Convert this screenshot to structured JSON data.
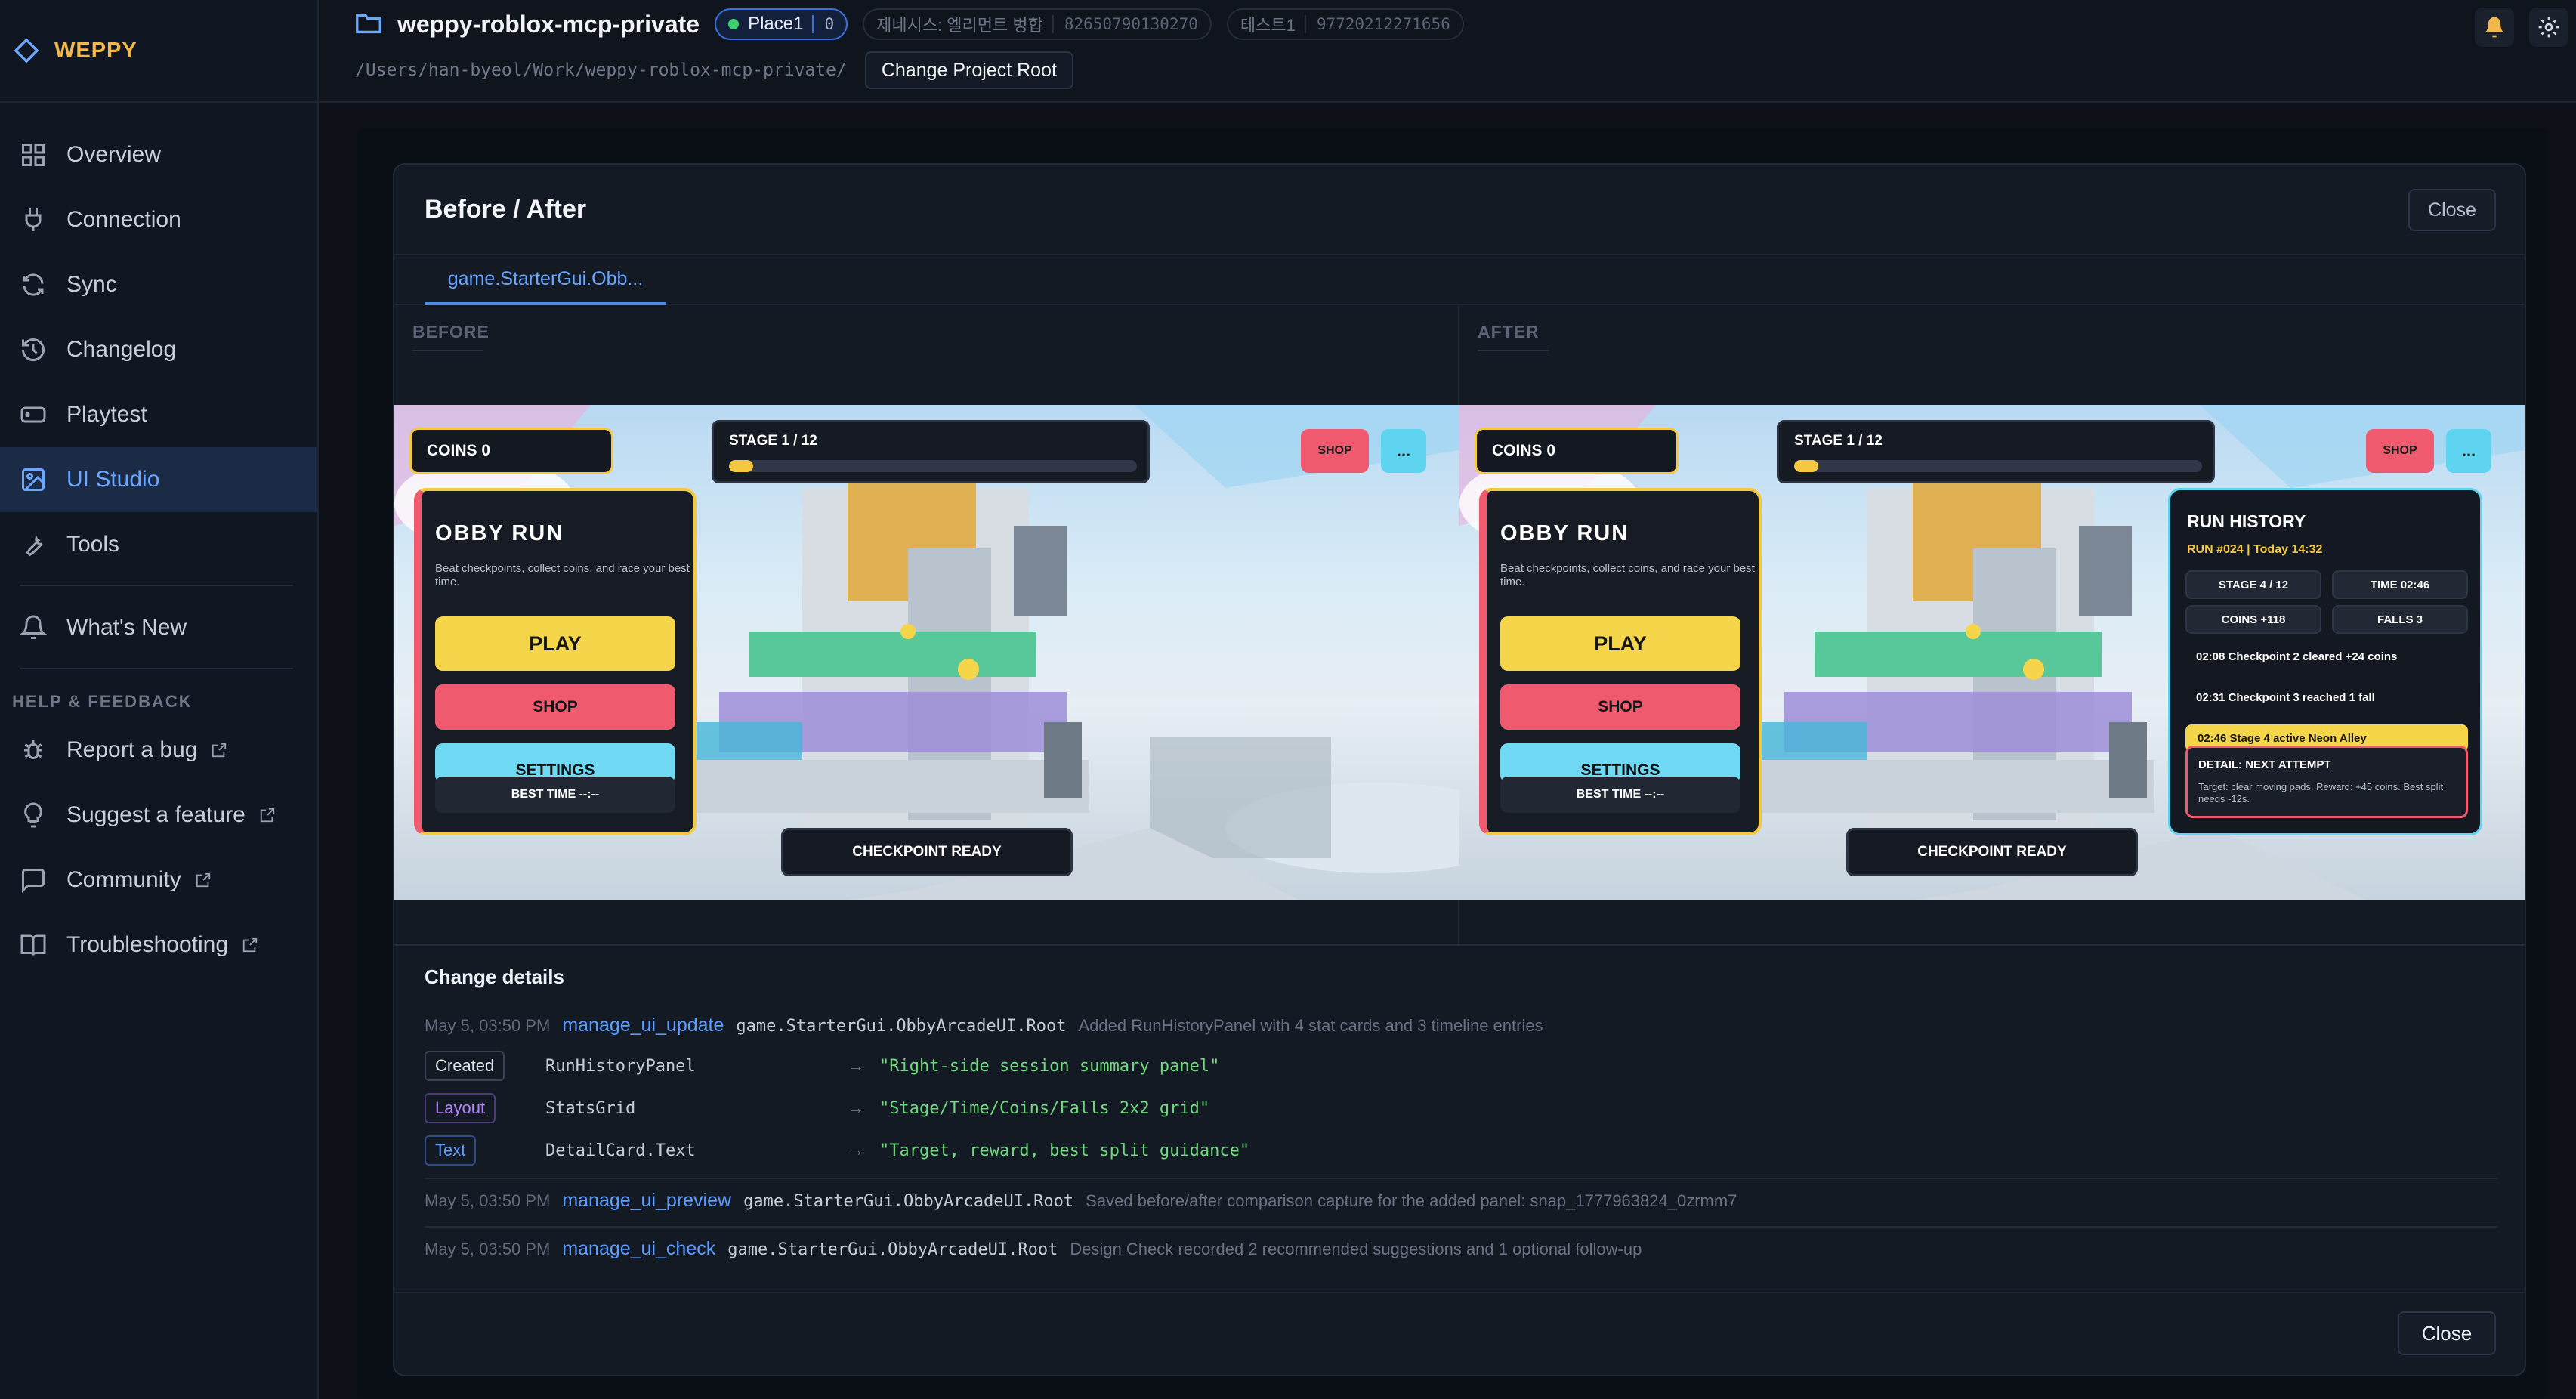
{
  "app": {
    "name": "WEPPY",
    "brand_color": "#f2b84b",
    "accent": "#6aa7ff"
  },
  "sidebar": {
    "items": [
      {
        "label": "Overview",
        "icon": "grid-icon"
      },
      {
        "label": "Connection",
        "icon": "plug-icon"
      },
      {
        "label": "Sync",
        "icon": "sync-icon"
      },
      {
        "label": "Changelog",
        "icon": "history-icon"
      },
      {
        "label": "Playtest",
        "icon": "gamepad-icon"
      },
      {
        "label": "UI Studio",
        "icon": "image-icon",
        "active": true
      },
      {
        "label": "Tools",
        "icon": "wrench-icon"
      }
    ],
    "whats_new": "What's New",
    "help_section": "HELP & FEEDBACK",
    "help_items": [
      {
        "label": "Report a bug",
        "icon": "bug-icon"
      },
      {
        "label": "Suggest a feature",
        "icon": "lightbulb-icon"
      },
      {
        "label": "Community",
        "icon": "chat-icon"
      },
      {
        "label": "Troubleshooting",
        "icon": "book-icon"
      }
    ]
  },
  "topbar": {
    "project": "weppy-roblox-mcp-private",
    "place_label": "Place1",
    "place_count": "0",
    "pill2_label": "제네시스: 엘리먼트 벙합",
    "pill2_id": "82650790130270",
    "pill3_label": "테스트1",
    "pill3_id": "97720212271656",
    "path": "/Users/han-byeol/Work/weppy-roblox-mcp-private/",
    "change_root": "Change Project Root"
  },
  "modal": {
    "title": "Before / After",
    "close": "Close",
    "tab": "game.StarterGui.Obb...",
    "before_label": "BEFORE",
    "after_label": "AFTER"
  },
  "game": {
    "coins": "COINS 0",
    "stage": "STAGE 1 / 12",
    "stage_progress": 0.06,
    "shop_mini": "SHOP",
    "more_mini": "...",
    "menu_title": "OBBY  RUN",
    "menu_sub": "Beat checkpoints, collect coins, and race your best time.",
    "play": "PLAY",
    "shop": "SHOP",
    "settings": "SETTINGS",
    "best_time": "BEST TIME  --:--",
    "checkpoint": "CHECKPOINT READY",
    "history": {
      "title": "RUN HISTORY",
      "run": "RUN #024  |  Today 14:32",
      "stats": [
        "STAGE 4 / 12",
        "TIME 02:46",
        "COINS +118",
        "FALLS 3"
      ],
      "timeline": [
        "02:08  Checkpoint 2 cleared  +24 coins",
        "02:31  Checkpoint 3 reached  1 fall",
        "02:46  Stage 4 active  Neon Alley"
      ],
      "detail_title": "DETAIL: NEXT ATTEMPT",
      "detail_text": "Target: clear moving pads. Reward: +45 coins. Best split needs -12s."
    }
  },
  "details": {
    "title": "Change details",
    "entries": [
      {
        "ts": "May 5, 03:50 PM",
        "tool": "manage_ui_update",
        "target": "game.StarterGui.ObbyArcadeUI.Root",
        "desc": "Added RunHistoryPanel with 4 stat cards and 3 timeline entries"
      },
      {
        "ts": "May 5, 03:50 PM",
        "tool": "manage_ui_preview",
        "target": "game.StarterGui.ObbyArcadeUI.Root",
        "desc": "Saved before/after comparison capture for the added panel: snap_1777963824_0zrmm7"
      },
      {
        "ts": "May 5, 03:50 PM",
        "tool": "manage_ui_check",
        "target": "game.StarterGui.ObbyArcadeUI.Root",
        "desc": "Design Check recorded 2 recommended suggestions and 1 optional follow-up"
      }
    ],
    "changes": [
      {
        "kind": "Created",
        "target": "RunHistoryPanel",
        "arrow": "→",
        "value": "\"Right-side session summary panel\""
      },
      {
        "kind": "Layout",
        "target": "StatsGrid",
        "arrow": "→",
        "value": "\"Stage/Time/Coins/Falls 2x2 grid\""
      },
      {
        "kind": "Text",
        "target": "DetailCard.Text",
        "arrow": "→",
        "value": "\"Target, reward, best split guidance\""
      }
    ]
  }
}
